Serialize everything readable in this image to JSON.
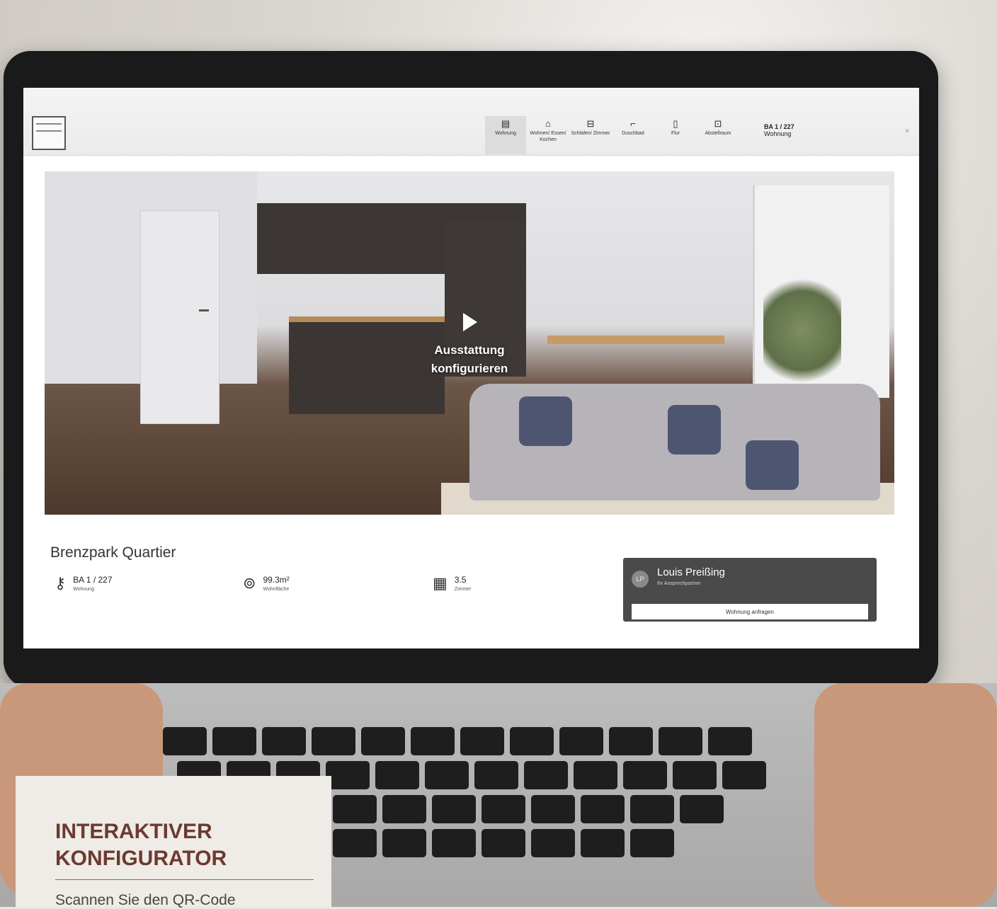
{
  "app": {
    "nav_items": [
      {
        "icon": "floorplan-icon",
        "label": "Wohnung",
        "active": true
      },
      {
        "icon": "sofa-icon",
        "label": "Wohnen/ Essen/ Kochen",
        "active": false
      },
      {
        "icon": "bed-icon",
        "label": "Schlafen/ Zimmer",
        "active": false
      },
      {
        "icon": "shower-icon",
        "label": "Duschbad",
        "active": false
      },
      {
        "icon": "door-icon",
        "label": "Flur",
        "active": false
      },
      {
        "icon": "storage-icon",
        "label": "Abstellraum",
        "active": false
      }
    ],
    "unit_summary": {
      "id": "BA 1 / 227",
      "label": "Wohnung"
    },
    "close_icon": "close-icon"
  },
  "hero": {
    "cta_label": "Ausstattung konfigurieren",
    "play_icon": "play-icon"
  },
  "project": {
    "title": "Brenzpark Quartier",
    "stats": [
      {
        "icon": "key-icon",
        "value": "BA 1 / 227",
        "label": "Wohnung"
      },
      {
        "icon": "area-icon",
        "value": "99.3m²",
        "label": "Wohnfläche"
      },
      {
        "icon": "rooms-icon",
        "value": "3.5",
        "label": "Zimmer"
      }
    ]
  },
  "contact": {
    "initials": "LP",
    "name": "Louis Preißing",
    "role": "Ihr Ansprechpartner",
    "button_label": "Wohnung anfragen"
  },
  "overlay_card": {
    "title": "INTERAKTIVER KONFIGURATOR",
    "text": "Scannen Sie den QR-Code"
  },
  "colors": {
    "card_title": "#6b3a30",
    "card_bg": "#efebe6",
    "contact_bg": "#4a4a4a"
  }
}
